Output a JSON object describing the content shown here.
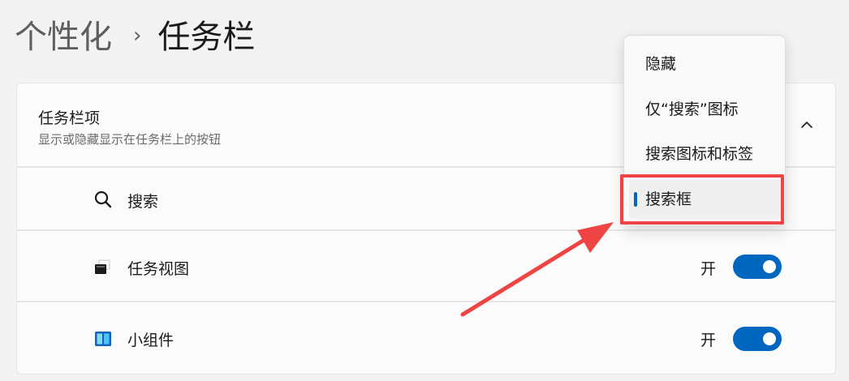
{
  "breadcrumb": {
    "parent": "个性化",
    "separator": "›",
    "current": "任务栏"
  },
  "section": {
    "title": "任务栏项",
    "subtitle": "显示或隐藏显示在任务栏上的按钮",
    "expand_icon": "chevron-up-icon"
  },
  "items": [
    {
      "label": "搜索",
      "icon": "search-icon"
    },
    {
      "label": "任务视图",
      "icon": "task-view-icon",
      "state": "开",
      "on": true
    },
    {
      "label": "小组件",
      "icon": "widgets-icon",
      "state": "开",
      "on": true
    }
  ],
  "search_menu": {
    "options": [
      "隐藏",
      "仅“搜索”图标",
      "搜索图标和标签",
      "搜索框"
    ],
    "selected": "搜索框"
  },
  "colors": {
    "accent": "#0067c0",
    "annotation": "#ee4444"
  }
}
